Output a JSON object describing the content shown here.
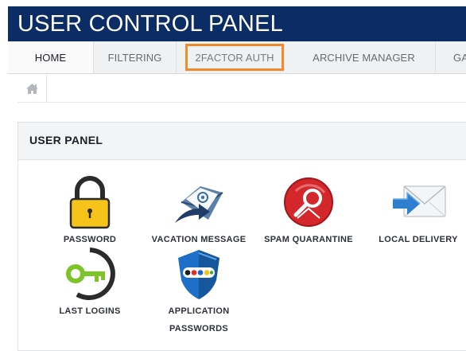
{
  "header": {
    "title": "USER CONTROL PANEL"
  },
  "tabs": [
    {
      "label": "HOME",
      "state": "active"
    },
    {
      "label": "FILTERING",
      "state": "normal"
    },
    {
      "label": "2FACTOR AUTH",
      "state": "highlighted"
    },
    {
      "label": "ARCHIVE MANAGER",
      "state": "normal"
    },
    {
      "label": "GA",
      "state": "normal"
    }
  ],
  "breadcrumb": {
    "icon": "home-icon"
  },
  "panel": {
    "title": "USER PANEL",
    "items": [
      {
        "label": "PASSWORD",
        "icon": "padlock-icon"
      },
      {
        "label": "VACATION MESSAGE",
        "icon": "email-send-icon"
      },
      {
        "label": "SPAM QUARANTINE",
        "icon": "spam-quarantine-icon"
      },
      {
        "label": "LOCAL DELIVERY",
        "icon": "envelope-arrow-icon"
      },
      {
        "label": "LAST LOGINS",
        "icon": "key-icon"
      },
      {
        "label_line1": "APPLICATION",
        "label_line2": "PASSWORDS",
        "icon": "shield-icon"
      }
    ]
  },
  "colors": {
    "title_bar": "#0c2c66",
    "tab_bar": "#f0f1f3",
    "highlight_border": "#f48a2e",
    "lock_yellow": "#f5c319",
    "spam_red": "#d3272b",
    "key_green": "#7cc42a",
    "shield_blue": "#1d6fc7"
  }
}
